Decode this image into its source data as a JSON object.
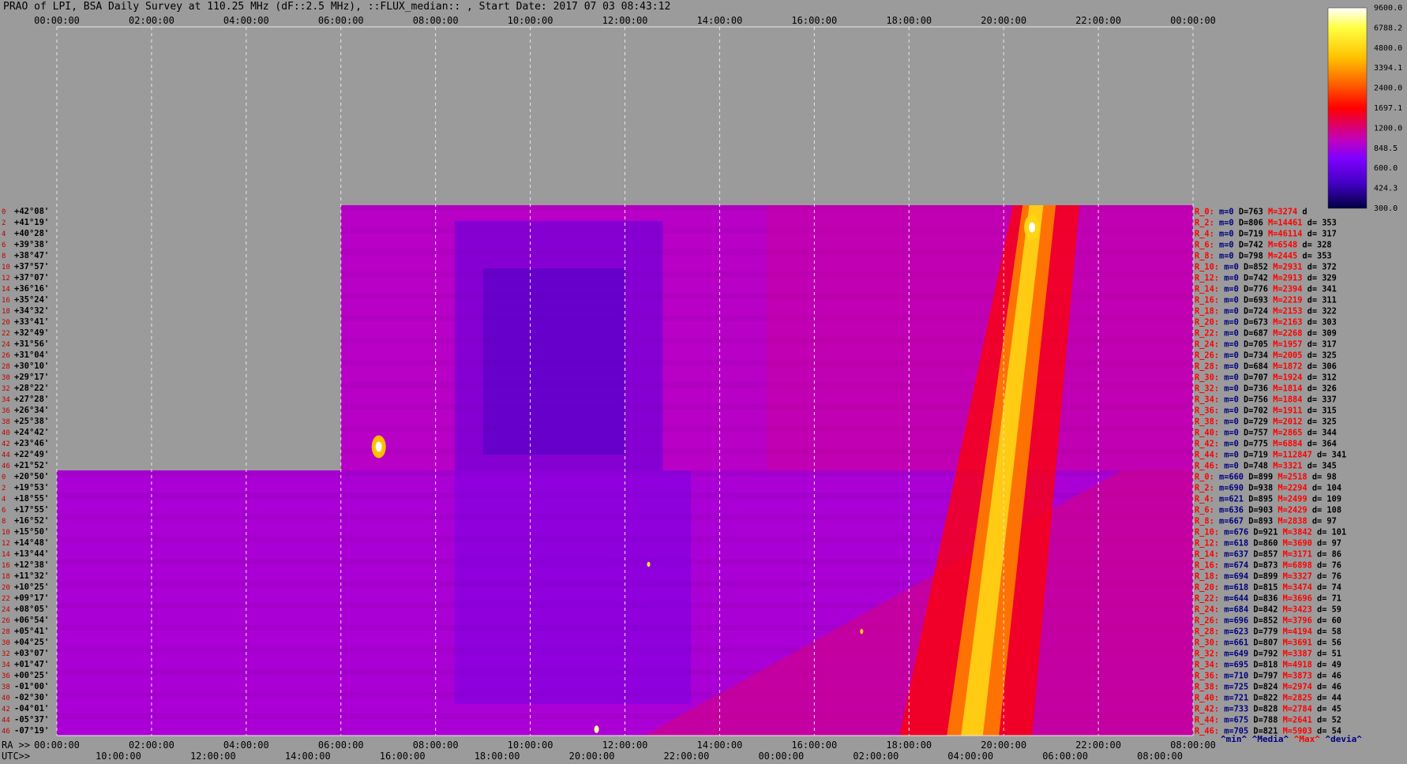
{
  "title": "PRAO of LPI, BSA Daily Survey at 110.25 MHz (dF::2.5 MHz), ::FLUX_median:: , Start Date: 2017 07 03 08:43:12",
  "chart_data": {
    "type": "heatmap",
    "title": "PRAO of LPI, BSA Daily Survey at 110.25 MHz (dF::2.5 MHz), ::FLUX_median:: , Start Date: 2017 07 03 08:43:12",
    "top_time_ticks": [
      "00:00:00",
      "02:00:00",
      "04:00:00",
      "06:00:00",
      "08:00:00",
      "10:00:00",
      "12:00:00",
      "14:00:00",
      "16:00:00",
      "18:00:00",
      "20:00:00",
      "22:00:00",
      "00:00:00"
    ],
    "bottom_ra_prefix": "RA >>",
    "bottom_ra_ticks": [
      "00:00:00",
      "02:00:00",
      "04:00:00",
      "06:00:00",
      "08:00:00",
      "10:00:00",
      "12:00:00",
      "14:00:00",
      "16:00:00",
      "18:00:00",
      "20:00:00",
      "22:00:00",
      "08:00:00"
    ],
    "bottom_utc_prefix": "UTC>>",
    "bottom_utc_ticks": [
      "10:00:00",
      "12:00:00",
      "14:00:00",
      "16:00:00",
      "18:00:00",
      "20:00:00",
      "22:00:00",
      "00:00:00",
      "02:00:00",
      "04:00:00",
      "06:00:00",
      "08:00:00"
    ],
    "colorbar": {
      "ticks": [
        "9600.0",
        "6788.2",
        "4800.0",
        "3394.1",
        "2400.0",
        "1697.1",
        "1200.0",
        "848.5",
        "600.0",
        "424.3",
        "300.0"
      ],
      "range": [
        300,
        9600
      ],
      "colors": [
        "#ffffff",
        "#ffff40",
        "#ffc000",
        "#ff6000",
        "#ff0000",
        "#e00060",
        "#c000c0",
        "#8000ff",
        "#4000c0",
        "#000040"
      ]
    },
    "declinations_upper": [
      "+42°08'",
      "+41°19'",
      "+40°28'",
      "+39°38'",
      "+38°47'",
      "+37°57'",
      "+37°07'",
      "+36°16'",
      "+35°24'",
      "+34°32'",
      "+33°41'",
      "+32°49'",
      "+31°56'",
      "+31°04'",
      "+30°10'",
      "+29°17'",
      "+28°22'",
      "+27°28'",
      "+26°34'",
      "+25°38'",
      "+24°42'",
      "+23°46'",
      "+22°49'",
      "+21°52'"
    ],
    "declinations_lower": [
      "+20°50'",
      "+19°53'",
      "+18°55'",
      "+17°55'",
      "+16°52'",
      "+15°50'",
      "+14°48'",
      "+13°44'",
      "+12°38'",
      "+11°32'",
      "+10°25'",
      "+09°17'",
      "+08°05'",
      "+06°54'",
      "+05°41'",
      "+04°25'",
      "+03°07'",
      "+01°47'",
      "+00°25'",
      "-01°00'",
      "-02°30'",
      "-04°01'",
      "-05°37'",
      "-07°19'"
    ],
    "row_indices_upper": [
      "0",
      "2",
      "4",
      "6",
      "8",
      "10",
      "12",
      "14",
      "16",
      "18",
      "20",
      "22",
      "24",
      "26",
      "28",
      "30",
      "32",
      "34",
      "36",
      "38",
      "40",
      "42",
      "44",
      "46"
    ],
    "row_indices_lower": [
      "0",
      "2",
      "4",
      "6",
      "8",
      "10",
      "12",
      "14",
      "16",
      "18",
      "20",
      "22",
      "24",
      "26",
      "28",
      "30",
      "32",
      "34",
      "36",
      "38",
      "40",
      "42",
      "44",
      "46"
    ],
    "stats": [
      {
        "r": "R_0:",
        "m": "m=0",
        "D": "D=763",
        "M": "M=3274",
        "d": "d"
      },
      {
        "r": "R_2:",
        "m": "m=0",
        "D": "D=806",
        "M": "M=14461",
        "d": "d= 353"
      },
      {
        "r": "R_4:",
        "m": "m=0",
        "D": "D=719",
        "M": "M=46114",
        "d": "d= 317"
      },
      {
        "r": "R_6:",
        "m": "m=0",
        "D": "D=742",
        "M": "M=6548",
        "d": "d= 328"
      },
      {
        "r": "R_8:",
        "m": "m=0",
        "D": "D=798",
        "M": "M=2445",
        "d": "d= 353"
      },
      {
        "r": "R_10:",
        "m": "m=0",
        "D": "D=852",
        "M": "M=2931",
        "d": "d= 372"
      },
      {
        "r": "R_12:",
        "m": "m=0",
        "D": "D=742",
        "M": "M=2913",
        "d": "d= 329"
      },
      {
        "r": "R_14:",
        "m": "m=0",
        "D": "D=776",
        "M": "M=2394",
        "d": "d= 341"
      },
      {
        "r": "R_16:",
        "m": "m=0",
        "D": "D=693",
        "M": "M=2219",
        "d": "d= 311"
      },
      {
        "r": "R_18:",
        "m": "m=0",
        "D": "D=724",
        "M": "M=2153",
        "d": "d= 322"
      },
      {
        "r": "R_20:",
        "m": "m=0",
        "D": "D=673",
        "M": "M=2163",
        "d": "d= 303"
      },
      {
        "r": "R_22:",
        "m": "m=0",
        "D": "D=687",
        "M": "M=2268",
        "d": "d= 309"
      },
      {
        "r": "R_24:",
        "m": "m=0",
        "D": "D=705",
        "M": "M=1957",
        "d": "d= 317"
      },
      {
        "r": "R_26:",
        "m": "m=0",
        "D": "D=734",
        "M": "M=2005",
        "d": "d= 325"
      },
      {
        "r": "R_28:",
        "m": "m=0",
        "D": "D=684",
        "M": "M=1872",
        "d": "d= 306"
      },
      {
        "r": "R_30:",
        "m": "m=0",
        "D": "D=707",
        "M": "M=1924",
        "d": "d= 312"
      },
      {
        "r": "R_32:",
        "m": "m=0",
        "D": "D=736",
        "M": "M=1814",
        "d": "d= 326"
      },
      {
        "r": "R_34:",
        "m": "m=0",
        "D": "D=756",
        "M": "M=1884",
        "d": "d= 337"
      },
      {
        "r": "R_36:",
        "m": "m=0",
        "D": "D=702",
        "M": "M=1911",
        "d": "d= 315"
      },
      {
        "r": "R_38:",
        "m": "m=0",
        "D": "D=729",
        "M": "M=2012",
        "d": "d= 325"
      },
      {
        "r": "R_40:",
        "m": "m=0",
        "D": "D=757",
        "M": "M=2865",
        "d": "d= 344"
      },
      {
        "r": "R_42:",
        "m": "m=0",
        "D": "D=775",
        "M": "M=6884",
        "d": "d= 364"
      },
      {
        "r": "R_44:",
        "m": "m=0",
        "D": "D=719",
        "M": "M=112847",
        "d": "d= 341"
      },
      {
        "r": "R_46:",
        "m": "m=0",
        "D": "D=748",
        "M": "M=3321",
        "d": "d= 345"
      },
      {
        "r": "R_0:",
        "m": "m=660",
        "D": "D=899",
        "M": "M=2518",
        "d": "d= 98"
      },
      {
        "r": "R_2:",
        "m": "m=690",
        "D": "D=938",
        "M": "M=2294",
        "d": "d= 104"
      },
      {
        "r": "R_4:",
        "m": "m=621",
        "D": "D=895",
        "M": "M=2499",
        "d": "d= 109"
      },
      {
        "r": "R_6:",
        "m": "m=636",
        "D": "D=903",
        "M": "M=2429",
        "d": "d= 108"
      },
      {
        "r": "R_8:",
        "m": "m=667",
        "D": "D=893",
        "M": "M=2838",
        "d": "d= 97"
      },
      {
        "r": "R_10:",
        "m": "m=676",
        "D": "D=921",
        "M": "M=3842",
        "d": "d= 101"
      },
      {
        "r": "R_12:",
        "m": "m=618",
        "D": "D=860",
        "M": "M=3690",
        "d": "d= 97"
      },
      {
        "r": "R_14:",
        "m": "m=637",
        "D": "D=857",
        "M": "M=3171",
        "d": "d= 86"
      },
      {
        "r": "R_16:",
        "m": "m=674",
        "D": "D=873",
        "M": "M=6898",
        "d": "d= 76"
      },
      {
        "r": "R_18:",
        "m": "m=694",
        "D": "D=899",
        "M": "M=3327",
        "d": "d= 76"
      },
      {
        "r": "R_20:",
        "m": "m=618",
        "D": "D=815",
        "M": "M=3474",
        "d": "d= 74"
      },
      {
        "r": "R_22:",
        "m": "m=644",
        "D": "D=836",
        "M": "M=3696",
        "d": "d= 71"
      },
      {
        "r": "R_24:",
        "m": "m=684",
        "D": "D=842",
        "M": "M=3423",
        "d": "d= 59"
      },
      {
        "r": "R_26:",
        "m": "m=696",
        "D": "D=852",
        "M": "M=3796",
        "d": "d= 60"
      },
      {
        "r": "R_28:",
        "m": "m=623",
        "D": "D=779",
        "M": "M=4194",
        "d": "d= 58"
      },
      {
        "r": "R_30:",
        "m": "m=661",
        "D": "D=807",
        "M": "M=3691",
        "d": "d= 56"
      },
      {
        "r": "R_32:",
        "m": "m=649",
        "D": "D=792",
        "M": "M=3387",
        "d": "d= 51"
      },
      {
        "r": "R_34:",
        "m": "m=695",
        "D": "D=818",
        "M": "M=4918",
        "d": "d= 49"
      },
      {
        "r": "R_36:",
        "m": "m=710",
        "D": "D=797",
        "M": "M=3873",
        "d": "d= 46"
      },
      {
        "r": "R_38:",
        "m": "m=725",
        "D": "D=824",
        "M": "M=2974",
        "d": "d= 46"
      },
      {
        "r": "R_40:",
        "m": "m=721",
        "D": "D=822",
        "M": "M=2825",
        "d": "d= 44"
      },
      {
        "r": "R_42:",
        "m": "m=733",
        "D": "D=828",
        "M": "M=2784",
        "d": "d= 45"
      },
      {
        "r": "R_44:",
        "m": "m=675",
        "D": "D=788",
        "M": "M=2641",
        "d": "d= 52"
      },
      {
        "r": "R_46:",
        "m": "m=705",
        "D": "D=821",
        "M": "M=5903",
        "d": "d= 54"
      }
    ],
    "stats_footer": [
      {
        "text": "^min^",
        "color": "#000080"
      },
      {
        "text": "^Media^",
        "color": "#000080"
      },
      {
        "text": "^Max^",
        "color": "#ff0000"
      },
      {
        "text": "^devia^",
        "color": "#000080"
      }
    ]
  }
}
